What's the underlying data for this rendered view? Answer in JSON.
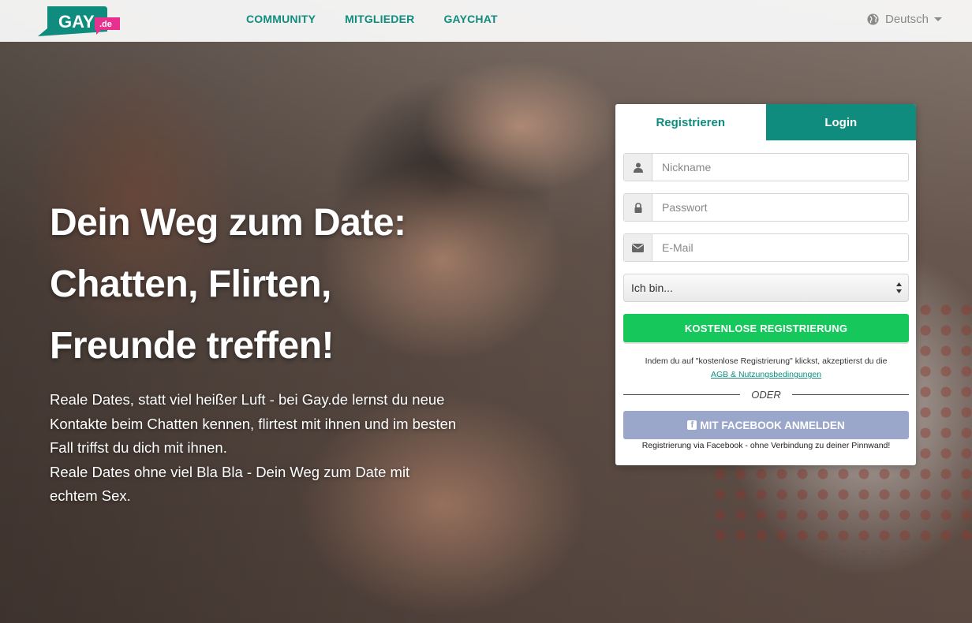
{
  "brand": {
    "logo_text": "GAY",
    "logo_tld": ".de",
    "primary_color": "#0f8c7e",
    "accent_color": "#e8308f"
  },
  "nav": {
    "items": [
      {
        "label": "COMMUNITY"
      },
      {
        "label": "MITGLIEDER"
      },
      {
        "label": "GAYCHAT"
      }
    ],
    "language": "Deutsch"
  },
  "hero": {
    "headline_lines": [
      "Dein Weg zum Date:",
      "Chatten, Flirten,",
      "Freunde treffen!"
    ],
    "paragraph_1": "Reale Dates, statt viel heißer Luft - bei Gay.de lernst du neue Kontakte beim Chatten kennen, flirtest mit ihnen und im besten Fall triffst du dich mit ihnen.",
    "paragraph_2": "Reale Dates ohne viel Bla Bla - Dein Weg zum Date mit echtem Sex."
  },
  "form": {
    "tabs": [
      {
        "label": "Registrieren",
        "active": true
      },
      {
        "label": "Login",
        "active": false
      }
    ],
    "nickname_placeholder": "Nickname",
    "password_placeholder": "Passwort",
    "email_placeholder": "E-Mail",
    "gender_select_value": "Ich bin...",
    "register_button": "KOSTENLOSE REGISTRIERUNG",
    "register_button_color": "#16c85b",
    "terms_text": "Indem du auf \"kostenlose Registrierung\" klickst, akzeptierst du die",
    "terms_link": "AGB & Nutzungsbedingungen",
    "separator": "ODER",
    "facebook_button": "MIT FACEBOOK ANMELDEN",
    "facebook_button_color": "#9aa7cb",
    "facebook_note": "Registrierung via Facebook - ohne Verbindung zu deiner Pinnwand!"
  }
}
